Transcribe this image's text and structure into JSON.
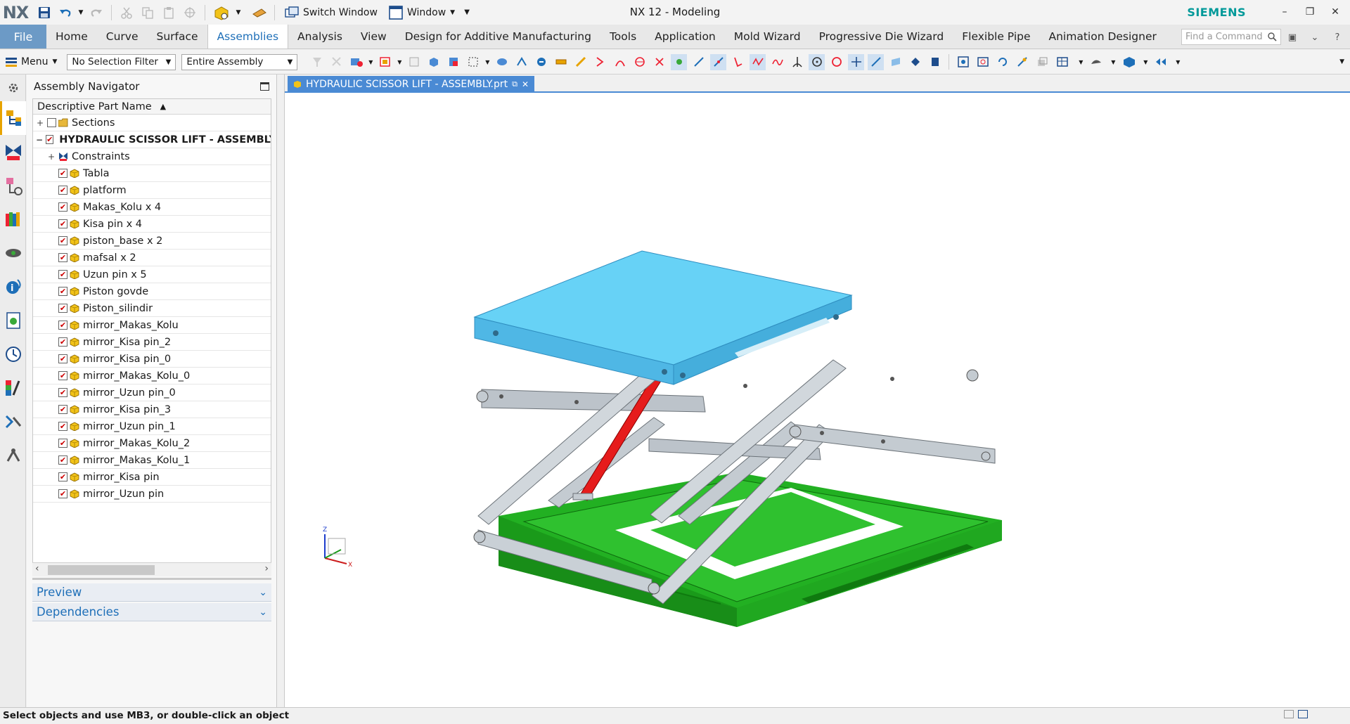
{
  "app": {
    "logo": "NX",
    "title": "NX 12 - Modeling",
    "brand": "SIEMENS",
    "switch_window_label": "Switch Window",
    "window_label": "Window"
  },
  "ribbon": {
    "file_label": "File",
    "tabs": [
      "Home",
      "Curve",
      "Surface",
      "Assemblies",
      "Analysis",
      "View",
      "Design for Additive Manufacturing",
      "Tools",
      "Application",
      "Mold Wizard",
      "Progressive Die Wizard",
      "Flexible Pipe",
      "Animation Designer"
    ],
    "active_tab": "Assemblies",
    "find_placeholder": "Find a Command"
  },
  "toolbar": {
    "menu_label": "Menu",
    "selection_filter": "No Selection Filter",
    "scope": "Entire Assembly"
  },
  "navigator": {
    "title": "Assembly Navigator",
    "column_header": "Descriptive Part Name",
    "sections_label": "Sections",
    "assembly_label": "HYDRAULIC SCISSOR LIFT - ASSEMBLY ...",
    "constraints_label": "Constraints",
    "parts": [
      "Tabla",
      "platform",
      "Makas_Kolu x 4",
      "Kisa pin x 4",
      "piston_base x 2",
      "mafsal x 2",
      "Uzun pin x 5",
      "Piston govde",
      "Piston_silindir",
      "mirror_Makas_Kolu",
      "mirror_Kisa pin_2",
      "mirror_Kisa pin_0",
      "mirror_Makas_Kolu_0",
      "mirror_Uzun pin_0",
      "mirror_Kisa pin_3",
      "mirror_Uzun pin_1",
      "mirror_Makas_Kolu_2",
      "mirror_Makas_Kolu_1",
      "mirror_Kisa pin",
      "mirror_Uzun pin"
    ],
    "preview_label": "Preview",
    "dependencies_label": "Dependencies"
  },
  "document": {
    "tab_label": "HYDRAULIC SCISSOR LIFT - ASSEMBLY.prt"
  },
  "status": {
    "message": "Select objects and use MB3, or double-click an object"
  },
  "colors": {
    "platform_top": "#67d2f6",
    "base_green": "#1fb51f",
    "piston_red": "#e61c1c",
    "arms_gray": "#c4cbd1",
    "accent": "#1e6fb8"
  }
}
